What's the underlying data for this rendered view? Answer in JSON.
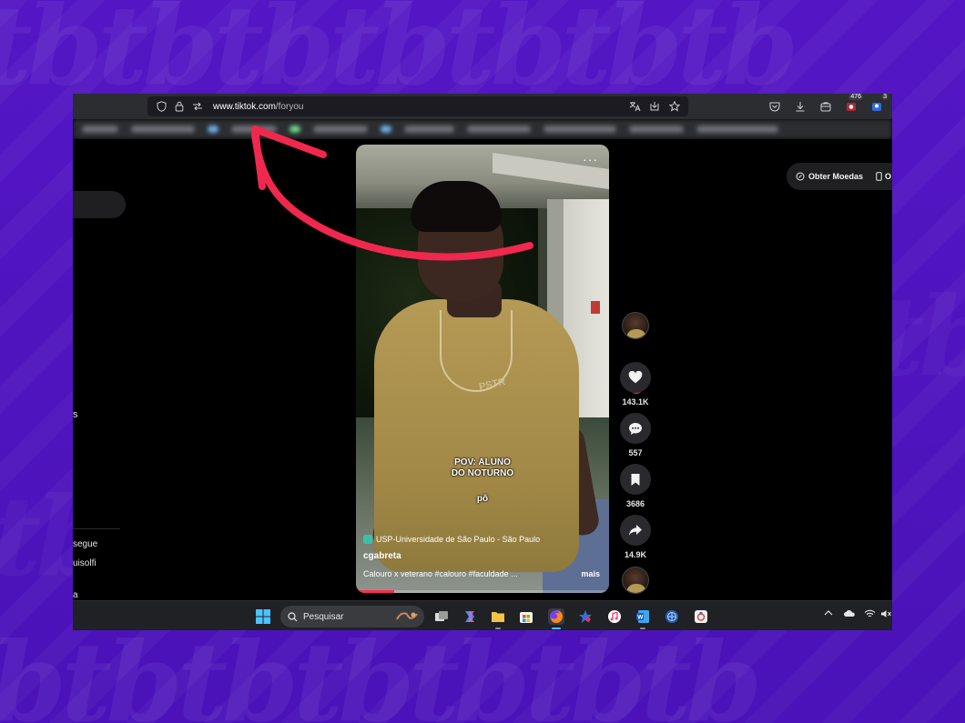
{
  "browser": {
    "url_host": "www.tiktok.com",
    "url_path": "/foryou",
    "toolbar_badges": {
      "extension_count": "476",
      "notification_count": "3"
    },
    "icons": [
      "shield-icon",
      "lock-icon",
      "permissions-icon",
      "translate-icon",
      "reader-icon",
      "bookmark-star-icon",
      "pocket-icon",
      "download-icon",
      "wallet-icon",
      "extension-icon",
      "profile-icon"
    ]
  },
  "header": {
    "coins_label": "Obter Moedas",
    "second_label": "O"
  },
  "left_sidebar": {
    "partial_text_1": "s",
    "partial_text_2": "segue",
    "partial_text_3": "uisolfi",
    "partial_text_4": "a"
  },
  "video": {
    "more_label": "···",
    "caption_line1": "POV: ALUNO",
    "caption_line2": "DO NOTURNO",
    "caption_sub": "pô",
    "shirt_print": "PSTR",
    "location": "USP-Universidade de São Paulo - São Paulo",
    "username": "cgabreta",
    "description": "Calouro x veterano  #calouro  #faculdade  ...",
    "more_text": "mais",
    "progress": 0.15
  },
  "actions": {
    "follow_label": "+",
    "likes": "143.1K",
    "comments": "557",
    "saves": "3686",
    "shares": "14.9K"
  },
  "taskbar": {
    "search_placeholder": "Pesquisar",
    "apps": [
      "windows-start-icon",
      "task-view-icon",
      "copilot-icon",
      "file-explorer-icon",
      "store-icon",
      "firefox-icon",
      "star-app-icon",
      "itunes-icon",
      "word-icon",
      "globe-app-icon",
      "capture-app-icon"
    ]
  },
  "colors": {
    "backdrop": "#4a12b8",
    "accent_red": "#fe2c55",
    "arrow": "#f0284e"
  }
}
